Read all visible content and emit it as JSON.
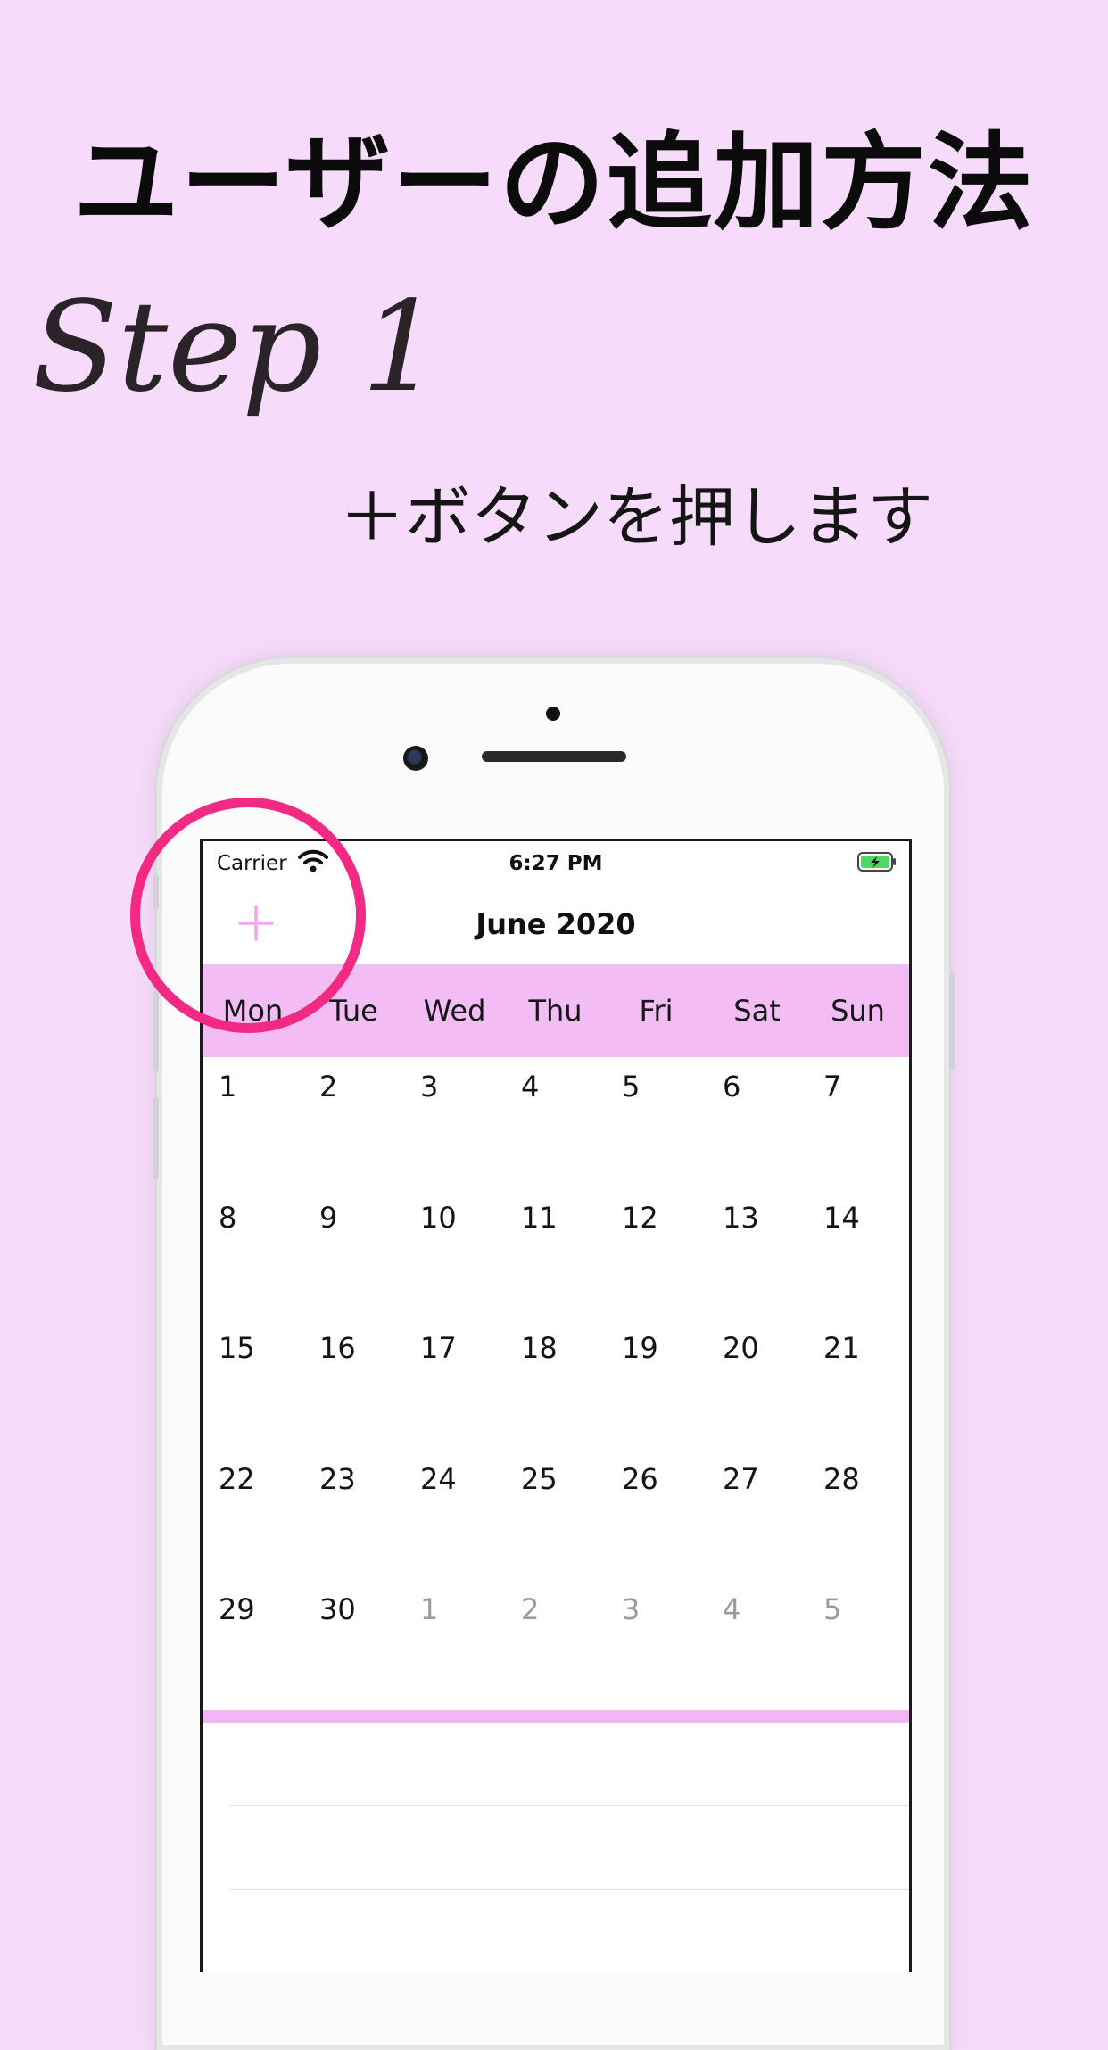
{
  "headline": "ユーザーの追加方法",
  "step_title": "Step 1",
  "instruction": "＋ボタンを押します",
  "status_bar": {
    "carrier": "Carrier",
    "time": "6:27 PM"
  },
  "nav": {
    "add_icon": "plus-icon",
    "month_title": "June 2020"
  },
  "weekdays": [
    "Mon",
    "Tue",
    "Wed",
    "Thu",
    "Fri",
    "Sat",
    "Sun"
  ],
  "calendar": {
    "days": [
      {
        "label": "1",
        "current_month": true
      },
      {
        "label": "2",
        "current_month": true
      },
      {
        "label": "3",
        "current_month": true
      },
      {
        "label": "4",
        "current_month": true
      },
      {
        "label": "5",
        "current_month": true
      },
      {
        "label": "6",
        "current_month": true
      },
      {
        "label": "7",
        "current_month": true
      },
      {
        "label": "8",
        "current_month": true
      },
      {
        "label": "9",
        "current_month": true
      },
      {
        "label": "10",
        "current_month": true
      },
      {
        "label": "11",
        "current_month": true
      },
      {
        "label": "12",
        "current_month": true
      },
      {
        "label": "13",
        "current_month": true
      },
      {
        "label": "14",
        "current_month": true
      },
      {
        "label": "15",
        "current_month": true
      },
      {
        "label": "16",
        "current_month": true
      },
      {
        "label": "17",
        "current_month": true
      },
      {
        "label": "18",
        "current_month": true
      },
      {
        "label": "19",
        "current_month": true
      },
      {
        "label": "20",
        "current_month": true
      },
      {
        "label": "21",
        "current_month": true
      },
      {
        "label": "22",
        "current_month": true
      },
      {
        "label": "23",
        "current_month": true
      },
      {
        "label": "24",
        "current_month": true
      },
      {
        "label": "25",
        "current_month": true
      },
      {
        "label": "26",
        "current_month": true
      },
      {
        "label": "27",
        "current_month": true
      },
      {
        "label": "28",
        "current_month": true
      },
      {
        "label": "29",
        "current_month": true
      },
      {
        "label": "30",
        "current_month": true
      },
      {
        "label": "1",
        "current_month": false
      },
      {
        "label": "2",
        "current_month": false
      },
      {
        "label": "3",
        "current_month": false
      },
      {
        "label": "4",
        "current_month": false
      },
      {
        "label": "5",
        "current_month": false
      }
    ]
  },
  "colors": {
    "background": "#f6dbfb",
    "accent_pink": "#f2bdf5",
    "highlight_ring": "#f22a84",
    "plus_icon": "#f3a6ec",
    "battery_green": "#4cd964"
  }
}
